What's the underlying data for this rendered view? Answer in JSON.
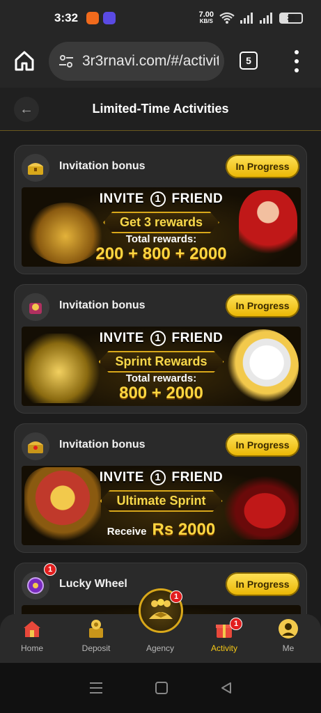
{
  "status_bar": {
    "time": "3:32",
    "net_speed": "7.00",
    "net_unit": "KB/S",
    "battery": "36"
  },
  "browser": {
    "url": "3r3rnavi.com/#/activit",
    "tab_count": "5"
  },
  "header": {
    "title": "Limited-Time Activities"
  },
  "cards": [
    {
      "title": "Invitation bonus",
      "status": "In Progress",
      "banner": {
        "line1_a": "INVITE",
        "line1_num": "1",
        "line1_b": "FRIEND",
        "ribbon": "Get 3 rewards",
        "sub": "Total rewards:",
        "big": "200 + 800 + 2000"
      }
    },
    {
      "title": "Invitation bonus",
      "status": "In Progress",
      "banner": {
        "line1_a": "INVITE",
        "line1_num": "1",
        "line1_b": "FRIEND",
        "ribbon": "Sprint Rewards",
        "sub": "Total rewards:",
        "big": "800 + 2000"
      }
    },
    {
      "title": "Invitation bonus",
      "status": "In Progress",
      "banner": {
        "line1_a": "INVITE",
        "line1_num": "1",
        "line1_b": "FRIEND",
        "ribbon": "Ultimate Sprint",
        "sub": "Receive",
        "big": "Rs 2000"
      }
    },
    {
      "title": "Lucky Wheel",
      "status": "In Progress",
      "badge": "1"
    }
  ],
  "bottom_nav": {
    "items": [
      {
        "label": "Home",
        "icon": "home-icon"
      },
      {
        "label": "Deposit",
        "icon": "deposit-icon"
      },
      {
        "label": "Agency",
        "icon": "agency-icon",
        "badge": "1"
      },
      {
        "label": "Activity",
        "icon": "gift-icon",
        "badge": "1",
        "active": true
      },
      {
        "label": "Me",
        "icon": "avatar-icon"
      }
    ]
  },
  "colors": {
    "accent": "#f6c817",
    "background": "#1c1c1c",
    "card": "#2a2a2a",
    "badge": "#e21e1e"
  }
}
